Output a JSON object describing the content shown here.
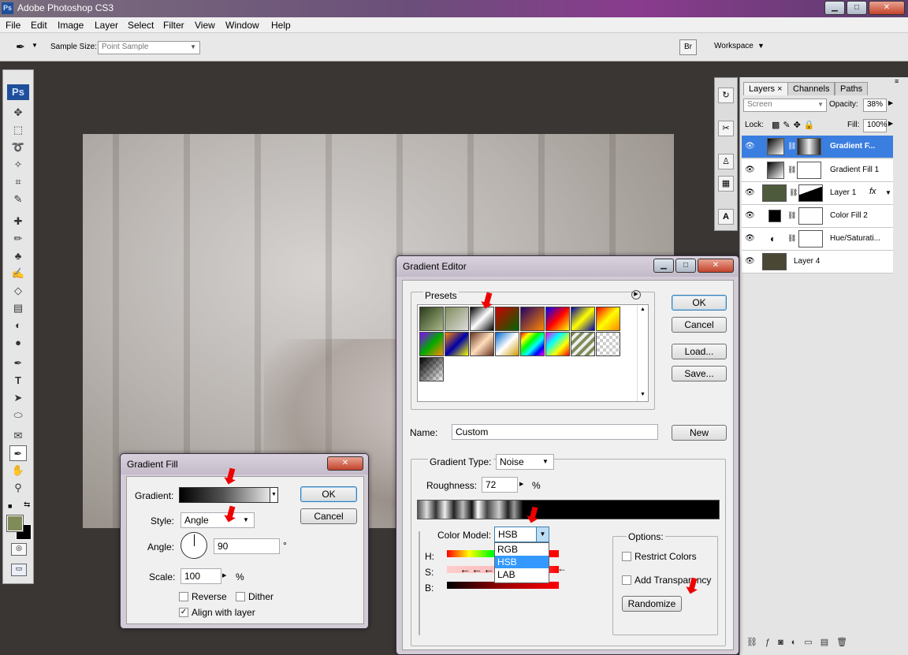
{
  "app": {
    "title": "Adobe Photoshop CS3",
    "logo": "Ps"
  },
  "menu": [
    "File",
    "Edit",
    "Image",
    "Layer",
    "Select",
    "Filter",
    "View",
    "Window",
    "Help"
  ],
  "options_bar": {
    "sample_size_label": "Sample Size:",
    "sample_size_value": "Point Sample",
    "workspace_label": "Workspace"
  },
  "layers_panel": {
    "tabs": [
      "Layers",
      "Channels",
      "Paths"
    ],
    "blend_mode": "Screen",
    "opacity_label": "Opacity:",
    "opacity_value": "38%",
    "lock_label": "Lock:",
    "fill_label": "Fill:",
    "fill_value": "100%",
    "layers": [
      {
        "name": "Gradient F..."
      },
      {
        "name": "Gradient Fill 1"
      },
      {
        "name": "Layer 1",
        "fx": "fx"
      },
      {
        "name": "Color Fill 2"
      },
      {
        "name": "Hue/Saturati..."
      },
      {
        "name": "Layer 4"
      }
    ]
  },
  "gradient_editor": {
    "title": "Gradient Editor",
    "presets_label": "Presets",
    "ok": "OK",
    "cancel": "Cancel",
    "load": "Load...",
    "save": "Save...",
    "name_label": "Name:",
    "name_value": "Custom",
    "new": "New",
    "gradient_type_label": "Gradient Type:",
    "gradient_type_value": "Noise",
    "roughness_label": "Roughness:",
    "roughness_value": "72",
    "roughness_unit": "%",
    "color_model_label": "Color Model:",
    "color_model_value": "HSB",
    "color_model_options": [
      "RGB",
      "HSB",
      "LAB"
    ],
    "channels": [
      "H:",
      "S:",
      "B:"
    ],
    "options_label": "Options:",
    "restrict_colors": "Restrict Colors",
    "add_transparency": "Add Transparency",
    "randomize": "Randomize"
  },
  "gradient_fill": {
    "title": "Gradient Fill",
    "gradient_label": "Gradient:",
    "style_label": "Style:",
    "style_value": "Angle",
    "angle_label": "Angle:",
    "angle_value": "90",
    "angle_unit": "°",
    "scale_label": "Scale:",
    "scale_value": "100",
    "scale_unit": "%",
    "reverse": "Reverse",
    "dither": "Dither",
    "align": "Align with layer",
    "ok": "OK",
    "cancel": "Cancel"
  },
  "colors": {
    "accent": "#3a7ee0",
    "arrow": "#e00000",
    "foreground": "#7f8c5a"
  }
}
